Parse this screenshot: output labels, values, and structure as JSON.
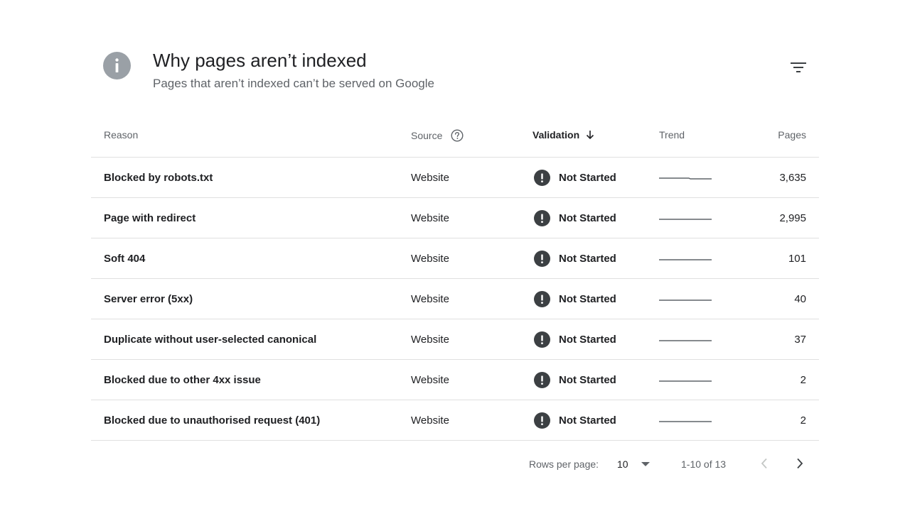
{
  "header": {
    "title": "Why pages aren’t indexed",
    "subtitle": "Pages that aren’t indexed can’t be served on Google",
    "icon": "info-icon",
    "filter_icon": "filter-icon"
  },
  "table": {
    "columns": {
      "reason": "Reason",
      "source": "Source",
      "validation": "Validation",
      "trend": "Trend",
      "pages": "Pages"
    },
    "sorted_by": "validation",
    "sort_direction": "descending",
    "rows": [
      {
        "reason": "Blocked by robots.txt",
        "source": "Website",
        "validation": "Not Started",
        "pages": "3,635"
      },
      {
        "reason": "Page with redirect",
        "source": "Website",
        "validation": "Not Started",
        "pages": "2,995"
      },
      {
        "reason": "Soft 404",
        "source": "Website",
        "validation": "Not Started",
        "pages": "101"
      },
      {
        "reason": "Server error (5xx)",
        "source": "Website",
        "validation": "Not Started",
        "pages": "40"
      },
      {
        "reason": "Duplicate without user-selected canonical",
        "source": "Website",
        "validation": "Not Started",
        "pages": "37"
      },
      {
        "reason": "Blocked due to other 4xx issue",
        "source": "Website",
        "validation": "Not Started",
        "pages": "2"
      },
      {
        "reason": "Blocked due to unauthorised request (401)",
        "source": "Website",
        "validation": "Not Started",
        "pages": "2"
      }
    ]
  },
  "pagination": {
    "rows_per_page_label": "Rows per page:",
    "rows_per_page_value": "10",
    "range": "1-10 of 13"
  },
  "colors": {
    "status_icon": "#3c4043",
    "info_icon": "#9aa0a6",
    "divider": "#e0e0e0"
  }
}
